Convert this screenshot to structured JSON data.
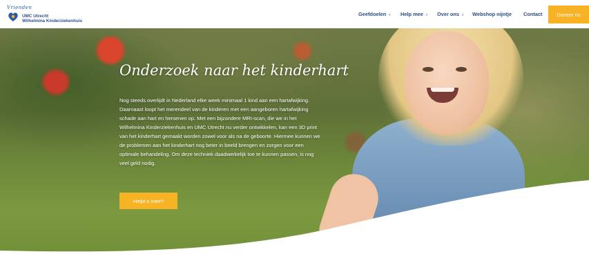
{
  "header": {
    "logo": {
      "arc_text": "Vrienden",
      "line1": "UMC Utrecht",
      "line2": "Wilhelmina Kinderziekenhuis"
    },
    "nav": [
      {
        "label": "Geefdoelen",
        "has_dropdown": true
      },
      {
        "label": "Help mee",
        "has_dropdown": true
      },
      {
        "label": "Over ons",
        "has_dropdown": true
      },
      {
        "label": "Webshop nijntje",
        "has_dropdown": false
      },
      {
        "label": "Contact",
        "has_dropdown": false
      }
    ],
    "donate_label": "Doneer nu"
  },
  "hero": {
    "title": "Onderzoek naar het kinderhart",
    "body": "Nog steeds overlijdt in Nederland elke week minimaal 1 kind aan een hartafwijking. Daarnaast loopt het merendeel van de kinderen met een aangeboren hartafwijking schade aan hart en hersenen op. Met een bijzondere MRI-scan, die we in het Wilhelmina Kinderziekenhuis en UMC Utrecht nu verder ontwikkelen, kan een 3D print van het kinderhart gemaakt worden zowel voor als na de geboorte. Hiermee kunnen we de problemen aan het kinderhart nog beter in beeld brengen en zorgen voor een optimale behandeling. Om deze techniek daadwerkelijk toe te kunnen passen, is nog veel geld nodig.",
    "cta_label": "Helpt u mee?"
  },
  "colors": {
    "brand_blue": "#2a4a8f",
    "accent_yellow": "#f7b324",
    "text_light": "#ffffff"
  },
  "icons": {
    "dropdown": "chevron-down-icon",
    "logo": "umc-heart-logo-icon"
  }
}
